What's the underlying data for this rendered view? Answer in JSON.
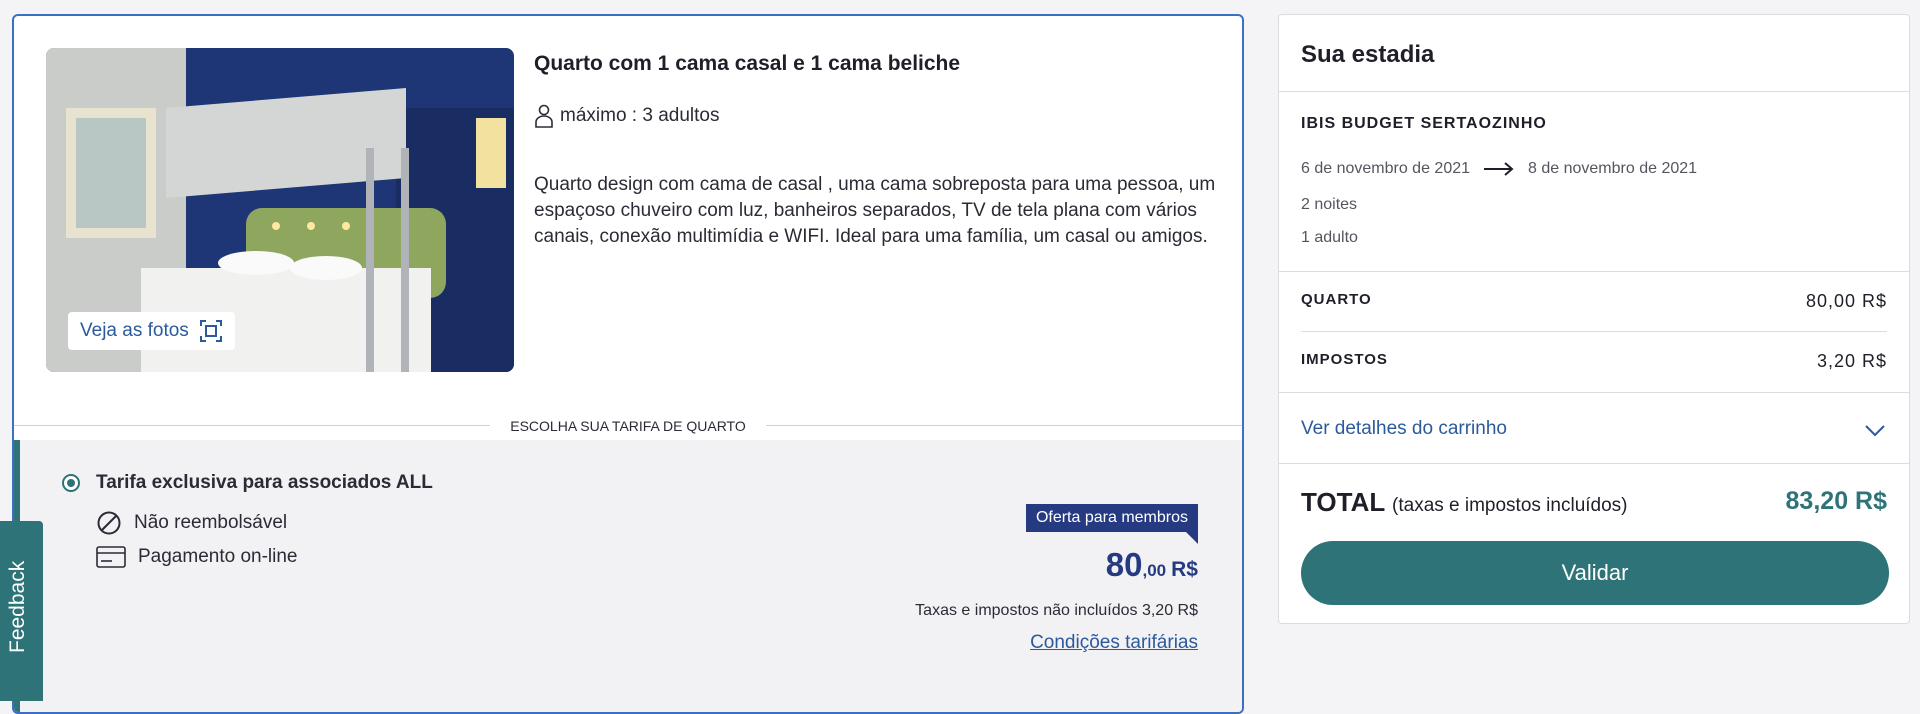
{
  "room": {
    "title": "Quarto com 1 cama casal e 1 cama beliche",
    "capacity": "máximo : 3 adultos",
    "description": "Quarto design com cama de casal , uma cama sobreposta para uma pessoa, um espaçoso chuveiro com luz, banheiros separados, TV de tela plana com vários canais, conexão multimídia e WIFI. Ideal para uma família, um casal ou amigos.",
    "photos_button": "Veja as fotos"
  },
  "rate_divider": "ESCOLHA SUA TARIFA DE QUARTO",
  "rate": {
    "name": "Tarifa exclusiva para associados ALL",
    "features": [
      "Não reembolsável",
      "Pagamento on-line"
    ],
    "badge": "Oferta para membros",
    "price_int": "80",
    "price_dec": ",00",
    "price_currency": "R$",
    "tax_note": "Taxas e impostos não incluídos 3,20 R$",
    "conditions_link": "Condições tarifárias"
  },
  "feedback": "Feedback",
  "summary": {
    "title": "Sua estadia",
    "hotel": "IBIS BUDGET SERTAOZINHO",
    "date_from": "6 de novembro de 2021",
    "date_to": "8 de novembro de 2021",
    "nights": "2 noites",
    "guests": "1 adulto",
    "room_label": "QUARTO",
    "room_value": "80,00 R$",
    "tax_label": "IMPOSTOS",
    "tax_value": "3,20 R$",
    "cart_details": "Ver detalhes do carrinho",
    "total_label": "TOTAL",
    "total_note": "(taxas e impostos incluídos)",
    "total_value": "83,20 R$",
    "validate_button": "Validar"
  },
  "colors": {
    "accent": "#2d7377",
    "brand_blue": "#263a82",
    "link": "#2b5a9c",
    "selection_border": "#3a6fc4"
  }
}
